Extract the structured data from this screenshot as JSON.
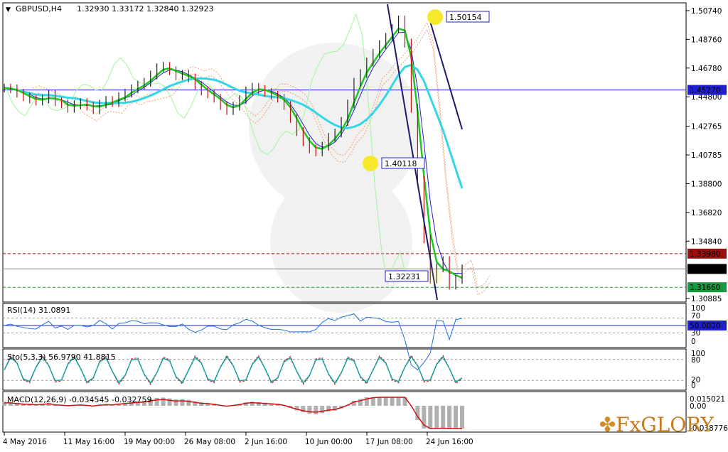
{
  "header": {
    "symbol": "GBPUSD,H4",
    "ohlc": "1.32930 1.33172 1.32840 1.32923"
  },
  "chart_data": {
    "type": "line",
    "title": "GBPUSD,H4",
    "price_axis": {
      "ylim": [
        1.30885,
        1.5074
      ],
      "ticks": [
        "1.50740",
        "1.48760",
        "1.46780",
        "1.44800",
        "1.42765",
        "1.40785",
        "1.38800",
        "1.36820",
        "1.34840",
        "1.30885"
      ]
    },
    "x_ticks": [
      "4 May 2016",
      "11 May 16:00",
      "19 May 00:00",
      "26 May 08:00",
      "2 Jun 16:00",
      "10 Jun 00:00",
      "17 Jun 08:00",
      "24 Jun 16:00"
    ],
    "price_markers": [
      {
        "label": "1.45270",
        "value": 1.4527,
        "color": "#1f1fd0",
        "style": "solid"
      },
      {
        "label": "1.33980",
        "value": 1.3398,
        "color": "#9a1010",
        "style": "dashed"
      },
      {
        "label": "1.32923",
        "value": 1.32923,
        "color": "#808080",
        "style": "solid"
      },
      {
        "label": "1.31660",
        "value": 1.3166,
        "color": "#1a9a40",
        "style": "dashed"
      }
    ],
    "annotations": [
      {
        "label": "1.50154",
        "value": 1.50154
      },
      {
        "label": "1.40118",
        "value": 1.40118
      },
      {
        "label": "1.32231",
        "value": 1.32231
      }
    ],
    "close_series": [
      1.454,
      1.4535,
      1.4505,
      1.448,
      1.4465,
      1.445,
      1.4465,
      1.4495,
      1.4445,
      1.443,
      1.44,
      1.4425,
      1.444,
      1.4415,
      1.439,
      1.443,
      1.4455,
      1.444,
      1.448,
      1.4505,
      1.4535,
      1.456,
      1.458,
      1.463,
      1.468,
      1.469,
      1.466,
      1.4625,
      1.4635,
      1.461,
      1.456,
      1.452,
      1.45,
      1.447,
      1.442,
      1.4385,
      1.4415,
      1.446,
      1.452,
      1.4545,
      1.453,
      1.451,
      1.449,
      1.447,
      1.442,
      1.433,
      1.424,
      1.417,
      1.412,
      1.41,
      1.414,
      1.42,
      1.423,
      1.431,
      1.443,
      1.458,
      1.464,
      1.472,
      1.478,
      1.484,
      1.489,
      1.495,
      1.501,
      1.485,
      1.44,
      1.39,
      1.35,
      1.3223,
      1.33,
      1.335,
      1.318,
      1.322,
      1.3292
    ],
    "indicators": {
      "rsi": {
        "label": "RSI(14) 31.0891",
        "level": "50.0000",
        "scale": [
          "100",
          "70",
          "30",
          "0"
        ]
      },
      "stoch": {
        "label": "Sto(5,3,3) 56.9790 41.8815",
        "scale": [
          "100",
          "80",
          "20",
          "0"
        ]
      },
      "macd": {
        "label": "MACD(12,26,9) -0.034545 -0.032759",
        "scale": [
          "0.015021",
          "0.00",
          "-0.038776"
        ]
      }
    },
    "colors": {
      "price": "#000000",
      "ma_green": "#1fc81f",
      "ma_cyan": "#34d7e6",
      "ma_blue": "#1f1fd0",
      "ichimoku_light": "#9ef59e",
      "cloud": "#f0a070",
      "channel": "#1a1a6e",
      "rsi": "#1e6fe0",
      "stoch_main": "#17a0a0",
      "stoch_signal": "#e01010",
      "macd_hist": "#b0b0b0",
      "macd_signal": "#d01010"
    },
    "grid": false
  },
  "branding": {
    "logo": "FxGLORY"
  }
}
